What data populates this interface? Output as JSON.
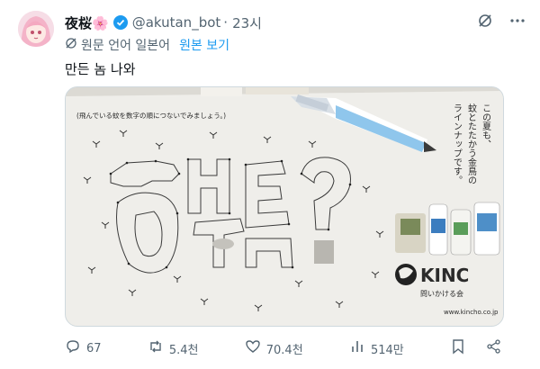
{
  "tweet": {
    "display_name": "夜桜🌸",
    "handle": "@akutan_bot",
    "separator": "·",
    "time": "23시",
    "translate_label": "원문 언어 일본어",
    "translate_link": "원본 보기",
    "text": "만든 놈 나와"
  },
  "media": {
    "instruction": "(飛んでいる蚊を数字の順につないでみましょう。)",
    "vertical_lines": [
      "この夏も、",
      "蚊とたたかう金鳥の",
      "ラインナップです。"
    ],
    "brand": "KINC",
    "brand_sub": "問いかける会",
    "url": "www.kincho.co.jp",
    "drawn_text": "ㅇㅂ?"
  },
  "actions": {
    "replies": "67",
    "reposts": "5.4천",
    "likes": "70.4천",
    "views": "514만"
  },
  "colors": {
    "accent": "#1d9bf0",
    "muted": "#536471",
    "verified": "#1d9bf0"
  }
}
